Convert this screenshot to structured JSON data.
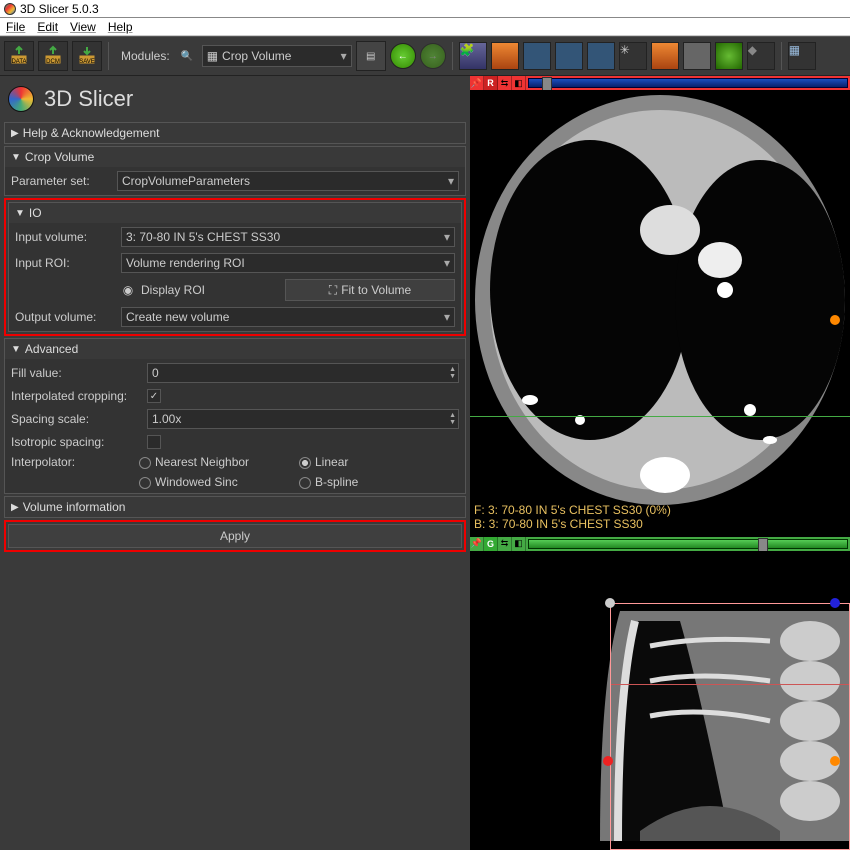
{
  "window": {
    "title": "3D Slicer 5.0.3"
  },
  "menu": {
    "file": "File",
    "edit": "Edit",
    "view": "View",
    "help": "Help"
  },
  "toolbar": {
    "modules_label": "Modules:",
    "module_selected": "Crop Volume"
  },
  "brand": {
    "title": "3D Slicer"
  },
  "sections": {
    "help": {
      "title": "Help & Acknowledgement"
    },
    "crop": {
      "title": "Crop Volume",
      "param_label": "Parameter set:",
      "param_value": "CropVolumeParameters"
    },
    "io": {
      "title": "IO",
      "input_volume_label": "Input volume:",
      "input_volume_value": "3: 70-80 IN 5's  CHEST SS30",
      "input_roi_label": "Input ROI:",
      "input_roi_value": "Volume rendering ROI",
      "display_roi": "Display ROI",
      "fit": "Fit to Volume",
      "output_label": "Output volume:",
      "output_value": "Create new volume"
    },
    "advanced": {
      "title": "Advanced",
      "fill_label": "Fill value:",
      "fill_value": "0",
      "interp_crop_label": "Interpolated cropping:",
      "spacing_label": "Spacing scale:",
      "spacing_value": "1.00x",
      "iso_label": "Isotropic spacing:",
      "interp_label": "Interpolator:",
      "nn": "Nearest Neighbor",
      "linear": "Linear",
      "ws": "Windowed Sinc",
      "bspline": "B-spline"
    },
    "volinfo": {
      "title": "Volume information"
    },
    "apply": "Apply"
  },
  "views": {
    "r_label": "R",
    "g_label": "G",
    "overlay_f": "F: 3: 70-80 IN 5's  CHEST SS30 (0%)",
    "overlay_b": "B: 3: 70-80 IN 5's  CHEST SS30"
  }
}
